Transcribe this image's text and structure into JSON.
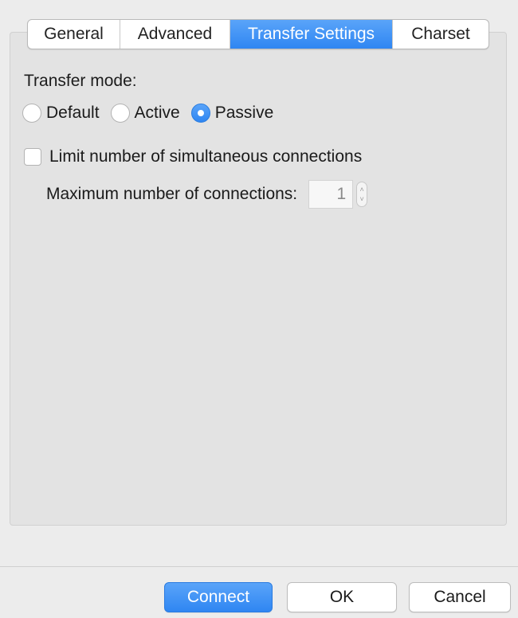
{
  "tabs": [
    {
      "label": "General",
      "selected": false
    },
    {
      "label": "Advanced",
      "selected": false
    },
    {
      "label": "Transfer Settings",
      "selected": true
    },
    {
      "label": "Charset",
      "selected": false
    }
  ],
  "transfer_mode": {
    "label": "Transfer mode:",
    "options": [
      {
        "label": "Default",
        "selected": false
      },
      {
        "label": "Active",
        "selected": false
      },
      {
        "label": "Passive",
        "selected": true
      }
    ]
  },
  "limit_connections": {
    "label": "Limit number of simultaneous connections",
    "checked": false
  },
  "max_connections": {
    "label": "Maximum number of connections:",
    "value": "1",
    "enabled": false
  },
  "buttons": {
    "connect": "Connect",
    "ok": "OK",
    "cancel": "Cancel"
  },
  "colors": {
    "accent": "#3a8ef5",
    "panel": "#e3e3e3",
    "window": "#ececec"
  }
}
